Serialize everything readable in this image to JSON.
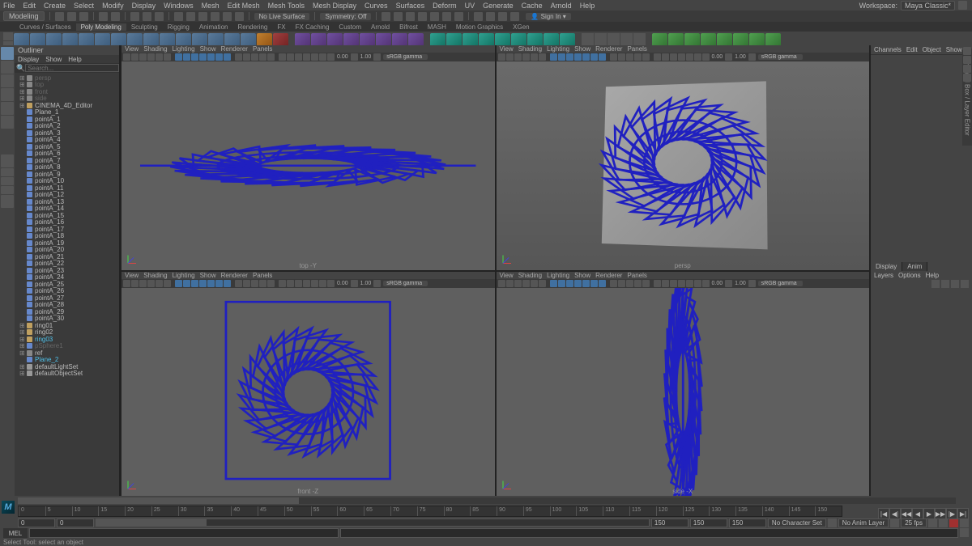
{
  "workspace_label": "Workspace:",
  "workspace_value": "Maya Classic*",
  "menubar": [
    "File",
    "Edit",
    "Create",
    "Select",
    "Modify",
    "Display",
    "Windows",
    "Mesh",
    "Edit Mesh",
    "Mesh Tools",
    "Mesh Display",
    "Curves",
    "Surfaces",
    "Deform",
    "UV",
    "Generate",
    "Cache",
    "Arnold",
    "Help"
  ],
  "module": "Modeling",
  "no_live": "No Live Surface",
  "symmetry": "Symmetry: Off",
  "sign_in": "Sign In",
  "shelf_tabs": [
    "Curves / Surfaces",
    "Poly Modeling",
    "Sculpting",
    "Rigging",
    "Animation",
    "Rendering",
    "FX",
    "FX Caching",
    "Custom",
    "Arnold",
    "Bifrost",
    "MASH",
    "Motion Graphics",
    "XGen"
  ],
  "outliner": {
    "title": "Outliner",
    "menu": [
      "Display",
      "Show",
      "Help"
    ],
    "search_placeholder": "Search...",
    "top_items": [
      "persp",
      "top",
      "front",
      "side"
    ],
    "editor": "CINEMA_4D_Editor",
    "plane": "Plane_1",
    "points_prefix": "pointA_",
    "points_count": 30,
    "rings": [
      "ring01",
      "ring02"
    ],
    "ring_dim": "ring03",
    "sphere_dim": "pSphere1",
    "ref": "ref",
    "plane2_dim": "Plane_2",
    "sets": [
      "defaultLightSet",
      "defaultObjectSet"
    ]
  },
  "vp_menu": [
    "View",
    "Shading",
    "Lighting",
    "Show",
    "Renderer",
    "Panels"
  ],
  "vp_tb": {
    "num0": "0.00",
    "num1": "1.00",
    "color": "sRGB gamma"
  },
  "vp_labels": {
    "tl": "top -Y",
    "tr": "persp",
    "bl": "front -Z",
    "br": "side -X"
  },
  "right": {
    "menu": [
      "Channels",
      "Edit",
      "Object",
      "Show"
    ],
    "layer_tabs": [
      "Display",
      "Anim"
    ],
    "layer_menu": [
      "Layers",
      "Options",
      "Help"
    ]
  },
  "side_tab": "Channel Box / Layer Editor",
  "timeline": {
    "ticks": [
      "0",
      "5",
      "10",
      "15",
      "20",
      "25",
      "30",
      "35",
      "40",
      "45",
      "50",
      "55",
      "60",
      "65",
      "70",
      "75",
      "80",
      "85",
      "90",
      "95",
      "100",
      "105",
      "110",
      "115",
      "120",
      "125",
      "130",
      "135",
      "140",
      "145",
      "150"
    ],
    "start": "0",
    "start_range": "0",
    "end_range": "150",
    "end": "150",
    "cur": "150",
    "no_char": "No Character Set",
    "no_anim": "No Anim Layer",
    "fps": "25 fps"
  },
  "cmd": {
    "label": "MEL"
  },
  "help": "Select Tool: select an object"
}
